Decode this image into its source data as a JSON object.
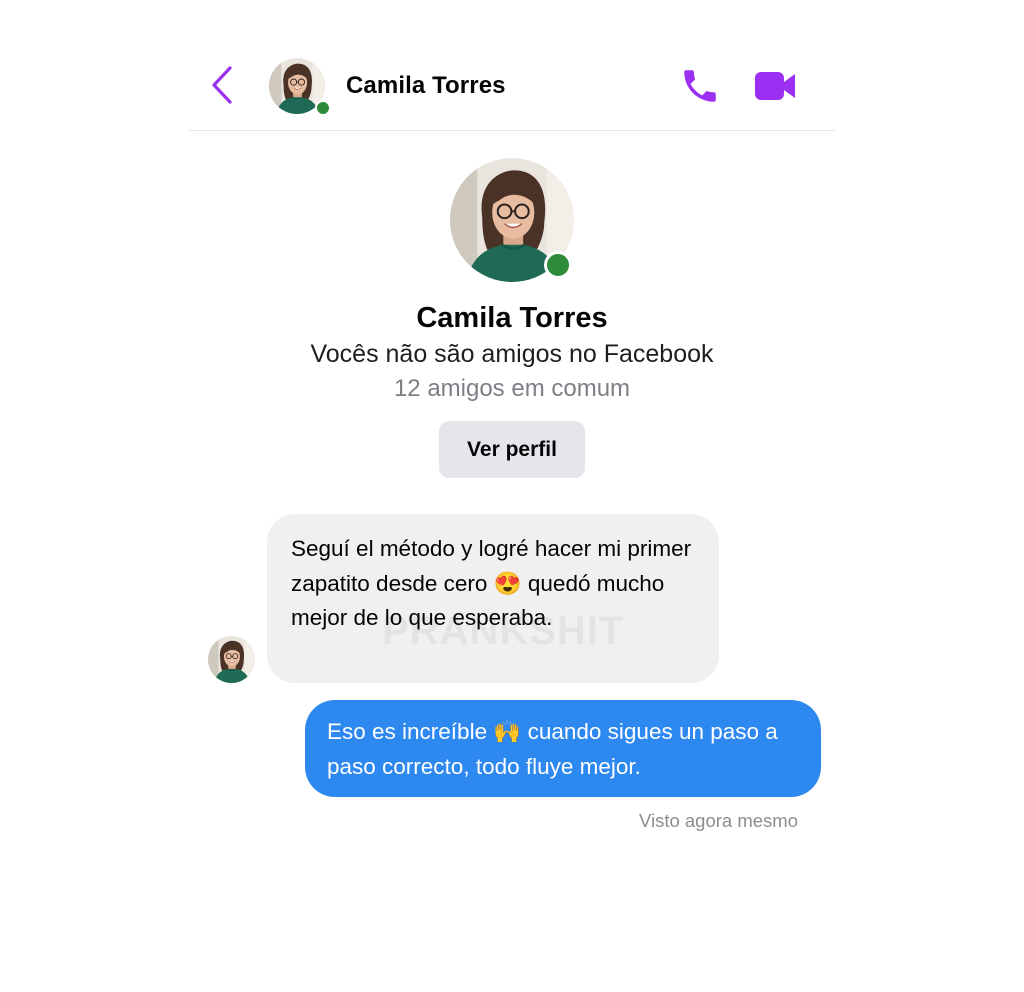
{
  "header": {
    "contact_name": "Camila Torres"
  },
  "profile": {
    "name": "Camila Torres",
    "relation": "Vocês não são amigos no Facebook",
    "mutual_friends": "12 amigos em comum",
    "view_profile_label": "Ver perfil"
  },
  "messages": [
    {
      "direction": "incoming",
      "text": "Seguí el método y logré hacer mi primer zapatito desde cero 😍 quedó mucho mejor de lo que esperaba."
    },
    {
      "direction": "outgoing",
      "text": "Eso es increíble 🙌 cuando sigues un paso a paso correcto, todo fluye mejor."
    }
  ],
  "watermark": "PRANKSHIT",
  "status": {
    "seen": "Visto agora mesmo"
  },
  "icons": {
    "back": "chevron-left-icon",
    "call": "phone-icon",
    "video": "video-camera-icon"
  },
  "colors": {
    "accent_purple": "#9b30f2",
    "outgoing_bubble": "#2d88f0",
    "incoming_bubble": "#f0f0f0",
    "online": "#2e8b3a",
    "button_bg": "#e4e6eb"
  }
}
